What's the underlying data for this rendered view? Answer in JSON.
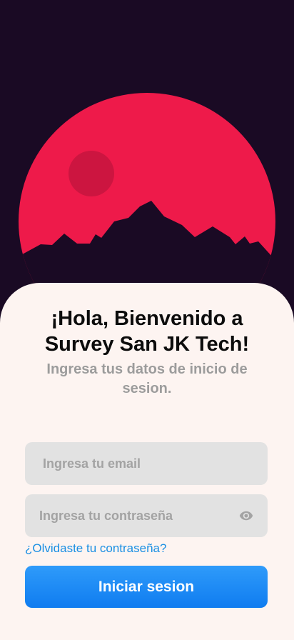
{
  "login": {
    "title_line1": "¡Hola, Bienvenido a",
    "title_line2": "Survey San JK Tech!",
    "subtitle": "Ingresa tus datos de inicio de sesion.",
    "email_placeholder": "Ingresa tu email",
    "email_value": "",
    "password_placeholder": "Ingresa tu contraseña",
    "password_value": "",
    "password_toggle_icon": "eye-icon",
    "forgot_password_link": "¿Olvidaste tu contraseña?",
    "submit_label": "Iniciar sesion"
  },
  "colors": {
    "background": "#1a0a24",
    "sun": "#ee1a4a",
    "moon": "#cc1540",
    "card": "#fdf4f1",
    "accent": "#1a8fe3",
    "button": "#0f7cf0"
  }
}
